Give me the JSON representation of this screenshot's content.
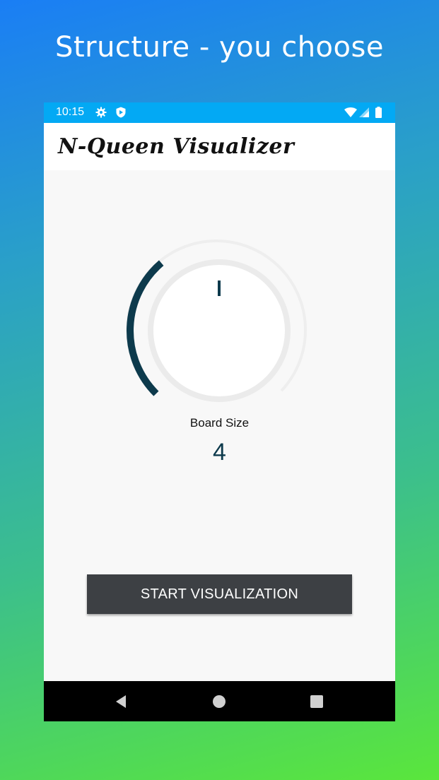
{
  "promo": {
    "title": "Structure - you choose"
  },
  "status_bar": {
    "time": "10:15",
    "icons": [
      "settings-icon",
      "shield-icon",
      "wifi-icon",
      "signal-icon",
      "battery-icon"
    ],
    "color": "#03a9f4"
  },
  "app_bar": {
    "title": "N-Queen Visualizer"
  },
  "board_size": {
    "label": "Board Size",
    "value": "4",
    "knob_level": 0.35,
    "accent": "#0d3a4c"
  },
  "actions": {
    "start_label": "START VISUALIZATION"
  },
  "nav_bar": {
    "icons": [
      "back-icon",
      "home-icon",
      "recents-icon"
    ]
  }
}
